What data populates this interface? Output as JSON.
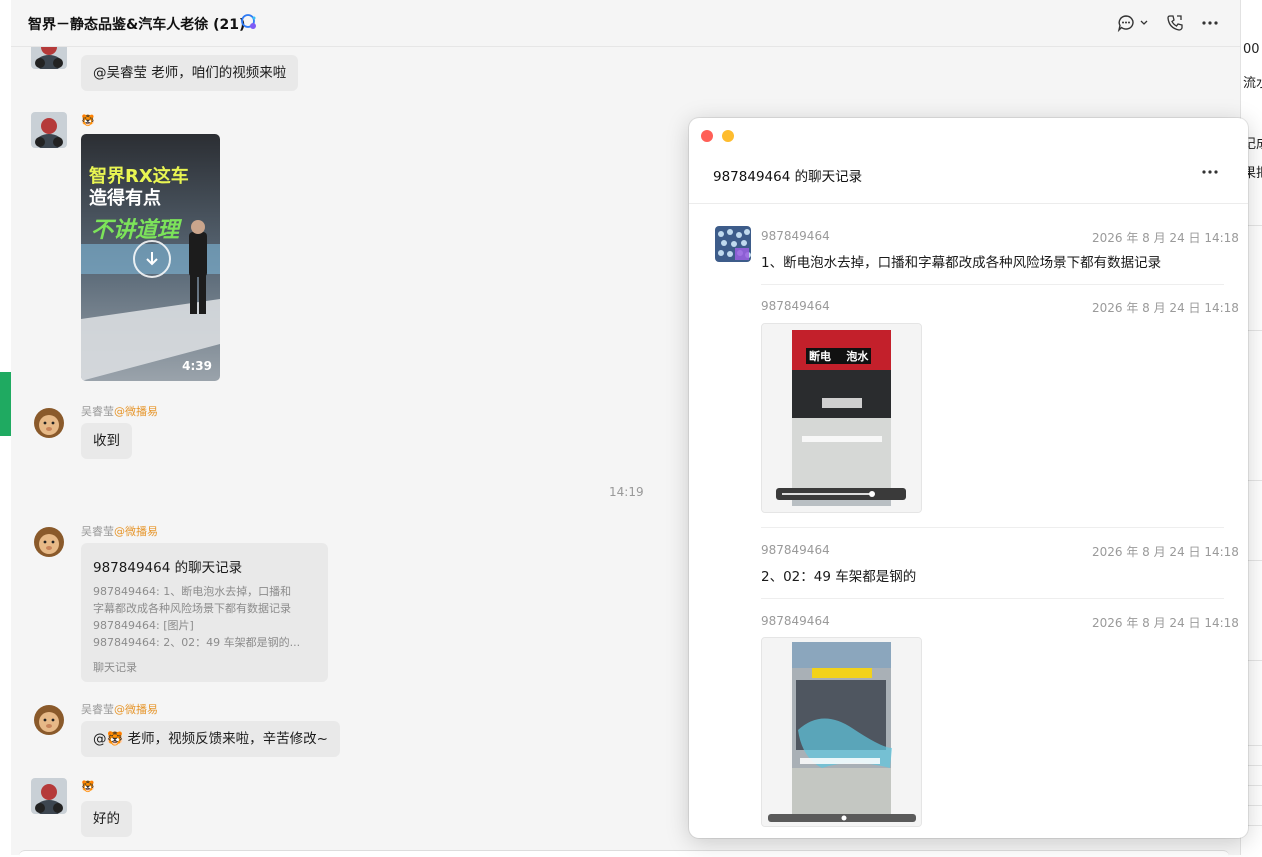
{
  "header": {
    "title": "智界－静态品鉴&汽车人老徐 (21)"
  },
  "messages": {
    "m1_text": "@吴睿莹 老师，咱们的视频来啦",
    "m2_sender": "🐯",
    "m2_video_duration": "4:39",
    "m2_video_overlay": [
      "智界RX这车",
      "造得有点",
      "不讲道理"
    ],
    "m3_sender": "吴睿莹",
    "m3_sender_suffix": "@微播易",
    "m3_text": "收到",
    "time_divider": "14:19",
    "m4_sender": "吴睿莹",
    "m4_sender_suffix": "@微播易",
    "m4_record_title": "987849464 的聊天记录",
    "m4_record_lines": [
      "987849464: 1、断电泡水去掉，口播和",
      "字幕都改成各种风险场景下都有数据记录",
      "987849464: [图片]",
      "987849464: 2、02：49 车架都是钢的..."
    ],
    "m4_record_footer": "聊天记录",
    "m5_sender": "吴睿莹",
    "m5_sender_suffix": "@微播易",
    "m5_text": "@🐯 老师，视频反馈来啦，辛苦修改~",
    "m6_sender": "🐯",
    "m6_text": "好的"
  },
  "popup": {
    "title": "987849464 的聊天记录",
    "items": [
      {
        "sender": "987849464",
        "time": "2026 年 8 月 24 日 14:18",
        "text": "1、断电泡水去掉，口播和字幕都改成各种风险场景下都有数据记录"
      },
      {
        "sender": "987849464",
        "time": "2026 年 8 月 24 日 14:18",
        "image_caption": "断电    泡水"
      },
      {
        "sender": "987849464",
        "time": "2026 年 8 月 24 日 14:18",
        "text": "2、02：49 车架都是钢的"
      },
      {
        "sender": "987849464",
        "time": "2026 年 8 月 24 日 14:18",
        "image_caption": ""
      }
    ]
  },
  "right_strip": [
    "00",
    "流水",
    "记成",
    "果把"
  ],
  "colors": {
    "accent_green": "#1faa61",
    "name_suffix": "#e6962c",
    "close_red": "#ff5f57",
    "minimize_yellow": "#febc2e"
  }
}
